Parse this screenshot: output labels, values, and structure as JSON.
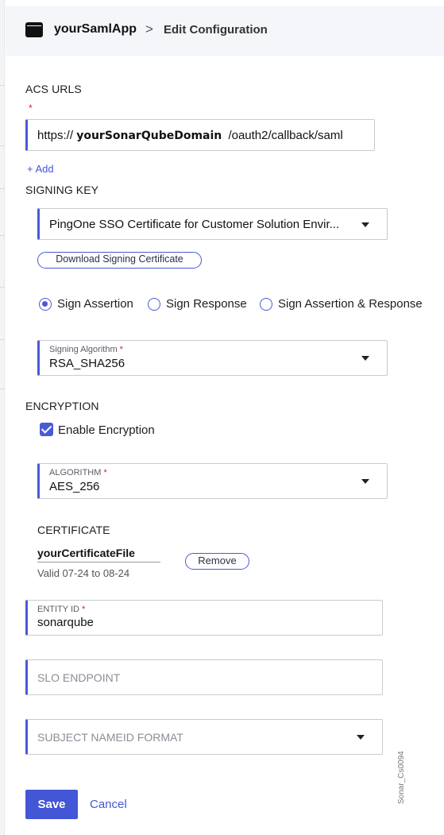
{
  "header": {
    "app_name": "yourSamlApp",
    "separator": ">",
    "page_title": "Edit Configuration"
  },
  "acs": {
    "label": "ACS URLS",
    "required": "*",
    "url_prefix": "https://",
    "url_domain": "yourSonarQubeDomain",
    "url_suffix": "/oauth2/callback/saml",
    "add_label": "+ Add"
  },
  "signing": {
    "label": "SIGNING KEY",
    "certificate_selected": "PingOne SSO Certificate for Customer Solution Envir...",
    "download_label": "Download Signing Certificate",
    "options": [
      {
        "label": "Sign Assertion",
        "selected": true
      },
      {
        "label": "Sign Response",
        "selected": false
      },
      {
        "label": "Sign Assertion & Response",
        "selected": false
      }
    ],
    "algorithm_label": "Signing Algorithm",
    "algorithm_required": "*",
    "algorithm_value": "RSA_SHA256"
  },
  "encryption": {
    "label": "ENCRYPTION",
    "enable_label": "Enable Encryption",
    "enabled": true,
    "algorithm_label": "ALGORITHM",
    "algorithm_required": "*",
    "algorithm_value": "AES_256",
    "certificate_label": "CERTIFICATE",
    "certificate_file": "yourCertificateFile",
    "certificate_validity": "Valid 07-24 to 08-24",
    "remove_label": "Remove"
  },
  "entity": {
    "label": "ENTITY ID",
    "required": "*",
    "value": "sonarqube"
  },
  "slo": {
    "placeholder": "SLO ENDPOINT"
  },
  "nameid": {
    "placeholder": "SUBJECT NAMEID FORMAT"
  },
  "actions": {
    "save_label": "Save",
    "cancel_label": "Cancel"
  },
  "watermark": "Sonar_Cs0094",
  "colors": {
    "accent": "#4356d6",
    "required": "#c62828",
    "header_bg": "#f4f6f9"
  }
}
